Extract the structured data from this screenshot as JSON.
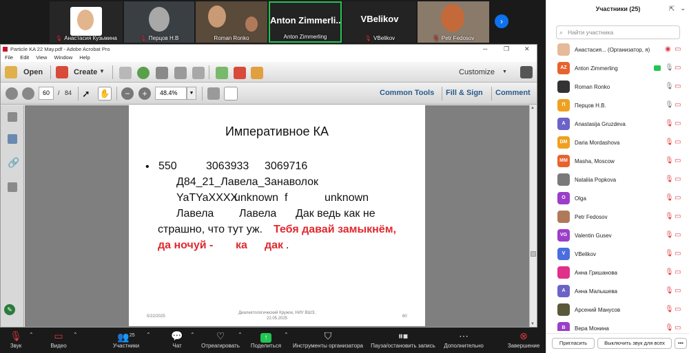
{
  "video_strip": {
    "tiles": [
      {
        "name": "Анастасия Кузьмина",
        "muted": true
      },
      {
        "name": "Перцов Н.В",
        "muted": true
      },
      {
        "name": "Roman Ronko",
        "muted": false
      },
      {
        "name": "Anton Zimmerling",
        "big": "Anton Zimmerli...",
        "muted": false
      },
      {
        "name": "VBelikov",
        "big": "VBelikov",
        "muted": true
      },
      {
        "name": "Petr Fedosov",
        "muted": true
      }
    ],
    "next_icon": "chevron-right-icon"
  },
  "acrobat": {
    "title": "Particle KA 22 May.pdf - Adobe Acrobat Pro",
    "menu": [
      "File",
      "Edit",
      "View",
      "Window",
      "Help"
    ],
    "toolbar1": {
      "open": "Open",
      "create": "Create",
      "customize": "Customize"
    },
    "toolbar2": {
      "page_current": "60",
      "page_sep": "/",
      "page_total": "84",
      "zoom": "48.4%",
      "common_tools": "Common Tools",
      "fill_sign": "Fill & Sign",
      "comment": "Comment"
    }
  },
  "slide": {
    "title": "Императивное КА",
    "bullet": "•",
    "line1": [
      "550",
      "3063933",
      "3069716"
    ],
    "line2": "Д84_21_Лавела_Занаволок",
    "line3": [
      "YaTYaXXXX",
      "unknown",
      "f",
      "unknown"
    ],
    "line4": [
      "Лавела",
      "Лавела",
      "Дак ведь как не"
    ],
    "line5_black": "страшно, что тут уж.",
    "line5_red": "Тебя давай замыкнём,",
    "line6_red": [
      "да ночуй -",
      "ка",
      "дак"
    ],
    "line6_end": ".",
    "footer_date": "5/22/2025",
    "footer_center_1": "Диалектологический Кружок, НИУ ВШЭ,",
    "footer_center_2": "22.05.2025",
    "footer_page": "60"
  },
  "participants": {
    "title": "Участники (25)",
    "search_placeholder": "Найти участника",
    "list": [
      {
        "name": "Анастасия... (Организатор, я)",
        "initials": "",
        "color": "#e6b99a",
        "mic": "rec"
      },
      {
        "name": "Anton Zimmerling",
        "initials": "AZ",
        "color": "#e8622e",
        "mic": "on"
      },
      {
        "name": "Roman Ronko",
        "initials": "",
        "color": "#333333",
        "mic": "on"
      },
      {
        "name": "Перцов Н.В.",
        "initials": "П",
        "color": "#f0a020",
        "mic": "on"
      },
      {
        "name": "Anastasija Gruzdeva",
        "initials": "A",
        "color": "#6b63c8",
        "mic": "off"
      },
      {
        "name": "Daria Mordashova",
        "initials": "DM",
        "color": "#f0a020",
        "mic": "off"
      },
      {
        "name": "Masha, Moscow",
        "initials": "MM",
        "color": "#e8622e",
        "mic": "off"
      },
      {
        "name": "Nataliia Popkova",
        "initials": "",
        "color": "#7a7a7a",
        "mic": "off"
      },
      {
        "name": "Olga",
        "initials": "O",
        "color": "#9b3ec9",
        "mic": "off"
      },
      {
        "name": "Petr Fedosov",
        "initials": "",
        "color": "#b07a5a",
        "mic": "off"
      },
      {
        "name": "Valentin Gusev",
        "initials": "VG",
        "color": "#9b3ec9",
        "mic": "off"
      },
      {
        "name": "VBelikov",
        "initials": "V",
        "color": "#4a6de0",
        "mic": "off"
      },
      {
        "name": "Анна Гришанова",
        "initials": "",
        "color": "#e0308a",
        "mic": "off"
      },
      {
        "name": "Анна Малышева",
        "initials": "A",
        "color": "#6b63c8",
        "mic": "off"
      },
      {
        "name": "Арсений Манусов",
        "initials": "",
        "color": "#5a5a3a",
        "mic": "off"
      },
      {
        "name": "Вера Монина",
        "initials": "В",
        "color": "#9b3ec9",
        "mic": "off"
      }
    ],
    "invite": "Пригласить",
    "mute_all": "Выключить звук для всех",
    "more": "•••"
  },
  "zoom_bar": {
    "audio": "Звук",
    "video": "Видео",
    "participants": "Участники",
    "participants_count": "25",
    "chat": "Чат",
    "react": "Отреагировать",
    "share": "Поделиться",
    "host_tools": "Инструменты организатора",
    "pause_rec": "Пауза/остановить запись",
    "more": "Дополнительно",
    "end": "Завершение"
  },
  "colors": {
    "accent": "#0e72ed",
    "red": "#e0282e",
    "share_green": "#23c552"
  }
}
